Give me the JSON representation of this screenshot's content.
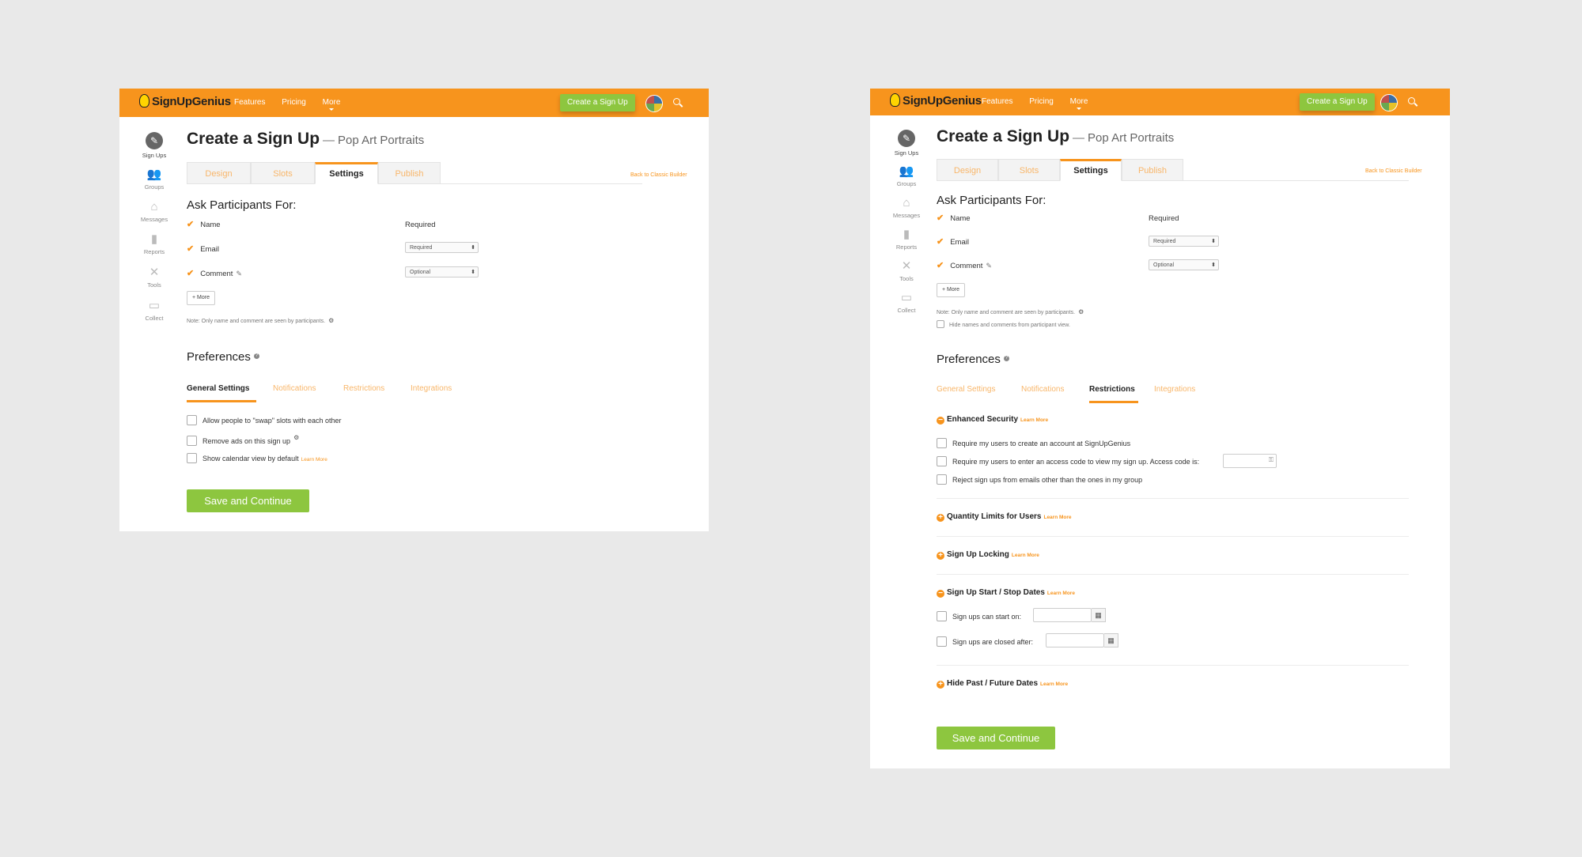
{
  "app": {
    "logo": "SignUpGenius",
    "nav": [
      "Features",
      "Pricing",
      "More"
    ],
    "cta": "Create a Sign Up"
  },
  "sidebar": [
    {
      "label": "Sign Ups",
      "icon": "clipboard-icon"
    },
    {
      "label": "Groups",
      "icon": "people-icon"
    },
    {
      "label": "Messages",
      "icon": "envelope-icon"
    },
    {
      "label": "Reports",
      "icon": "bar-chart-icon"
    },
    {
      "label": "Tools",
      "icon": "wrench-icon"
    },
    {
      "label": "Collect",
      "icon": "cash-icon"
    }
  ],
  "page": {
    "title": "Create a Sign Up",
    "dash": "—",
    "subtitle": "Pop Art Portraits",
    "tabs": [
      "Design",
      "Slots",
      "Settings",
      "Publish"
    ],
    "back_link": "Back to Classic Builder",
    "ask_heading": "Ask Participants For:",
    "required_label": "Required",
    "fields": [
      "Name",
      "Email",
      "Comment"
    ],
    "email_select": "Required",
    "comment_select": "Optional",
    "more_button": "+ More",
    "note": "Note: Only name and comment are seen by participants.",
    "hide_names": "Hide names and comments from participant view.",
    "preferences": "Preferences",
    "pref_tabs": [
      "General Settings",
      "Notifications",
      "Restrictions",
      "Integrations"
    ],
    "general_options": [
      "Allow people to \"swap\" slots with each other",
      "Remove ads on this sign up",
      "Show calendar view by default"
    ],
    "learn_more": "Learn More",
    "save": "Save and Continue"
  },
  "restrictions": {
    "enhanced_security": "Enhanced Security",
    "security_options": [
      "Require my users to create an account at SignUpGenius",
      "Require my users to enter an access code to view my sign up. Access code is:",
      "Reject sign ups from emails other than the ones in my group"
    ],
    "quantity_limits": "Quantity Limits for Users",
    "locking": "Sign Up Locking",
    "start_stop": "Sign Up Start / Stop Dates",
    "start_label": "Sign ups can start on:",
    "closed_label": "Sign ups are closed after:",
    "hide_dates": "Hide Past / Future Dates"
  },
  "colors": {
    "brand": "#f7941d",
    "cta": "#8dc63f",
    "background": "#e9e9e9"
  }
}
